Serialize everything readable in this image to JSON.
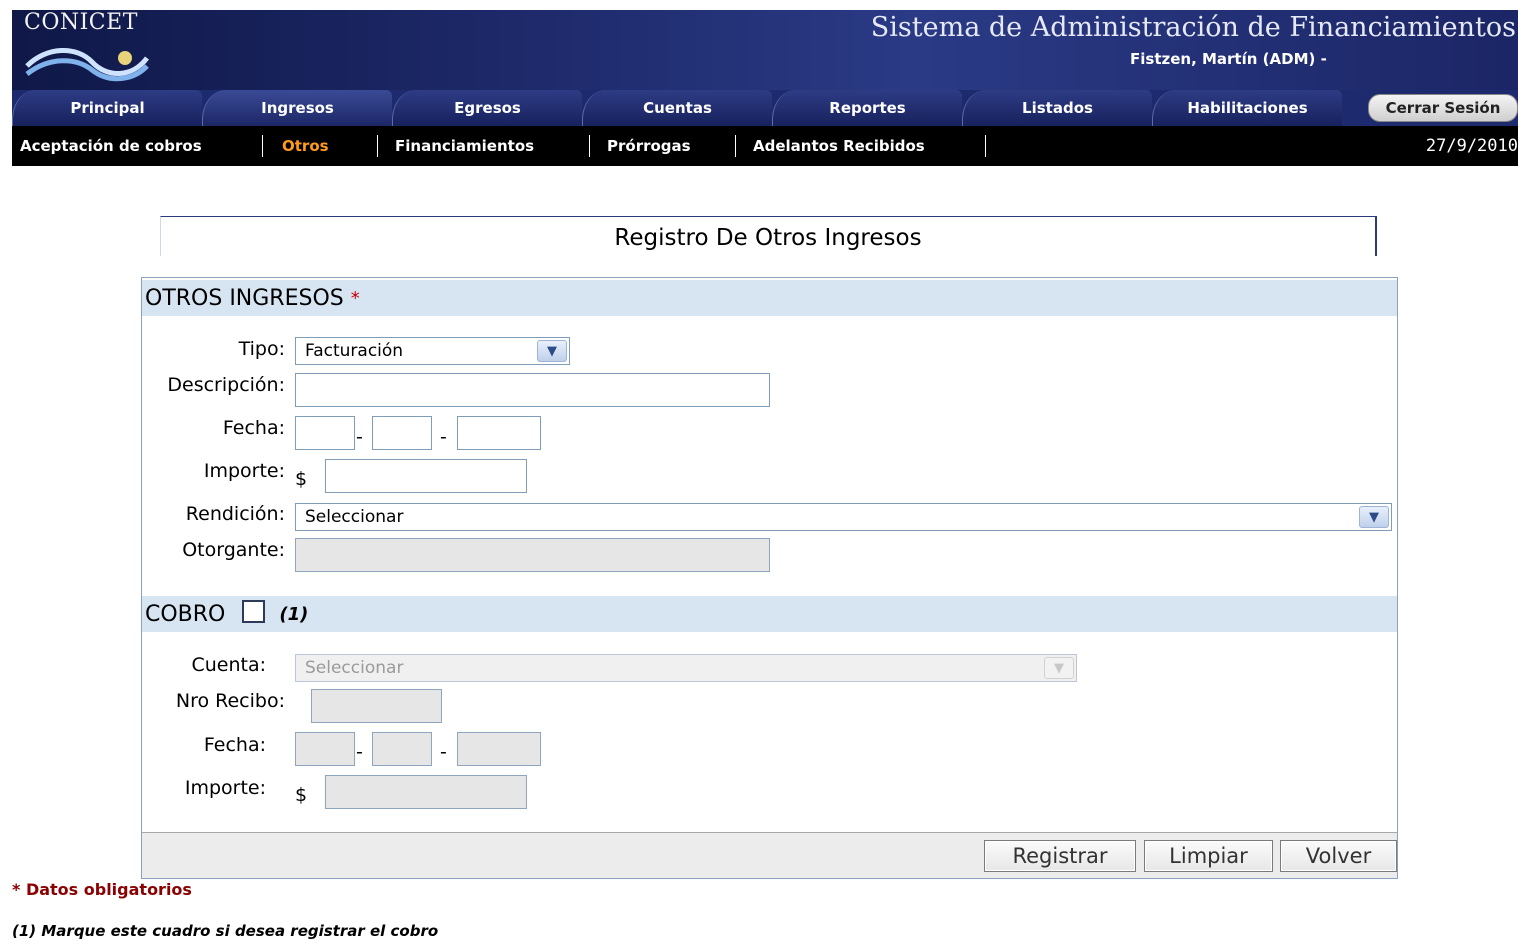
{
  "header": {
    "logo_text": "CONICET",
    "system_title": "Sistema de Administración de Financiamientos",
    "user": "Fistzen, Martín (ADM) -"
  },
  "tabs": [
    {
      "label": "Principal"
    },
    {
      "label": "Ingresos"
    },
    {
      "label": "Egresos"
    },
    {
      "label": "Cuentas"
    },
    {
      "label": "Reportes"
    },
    {
      "label": "Listados"
    },
    {
      "label": "Habilitaciones"
    }
  ],
  "logout_label": "Cerrar Sesión",
  "subnav": {
    "items": [
      {
        "label": "Aceptación de cobros"
      },
      {
        "label": "Otros"
      },
      {
        "label": "Financiamientos"
      },
      {
        "label": "Prórrogas"
      },
      {
        "label": "Adelantos Recibidos"
      }
    ],
    "date": "27/9/2010"
  },
  "page_title": "Registro De Otros Ingresos",
  "otros": {
    "heading": "OTROS INGRESOS",
    "required_mark": "*",
    "tipo_label": "Tipo:",
    "tipo_value": "Facturación",
    "descripcion_label": "Descripción:",
    "fecha_label": "Fecha:",
    "importe_label": "Importe:",
    "currency": "$",
    "rendicion_label": "Rendición:",
    "rendicion_value": "Seleccionar",
    "otorgante_label": "Otorgante:"
  },
  "cobro": {
    "heading": "COBRO",
    "note": "(1)",
    "cuenta_label": "Cuenta:",
    "cuenta_value": "Seleccionar",
    "recibo_label": "Nro Recibo:",
    "fecha_label": "Fecha:",
    "importe_label": "Importe:",
    "currency": "$"
  },
  "buttons": {
    "registrar": "Registrar",
    "limpiar": "Limpiar",
    "volver": "Volver"
  },
  "notes": {
    "required": "* Datos obligatorios",
    "cobro": "(1) Marque este cuadro si desea registrar el cobro"
  },
  "date_separator": "-"
}
